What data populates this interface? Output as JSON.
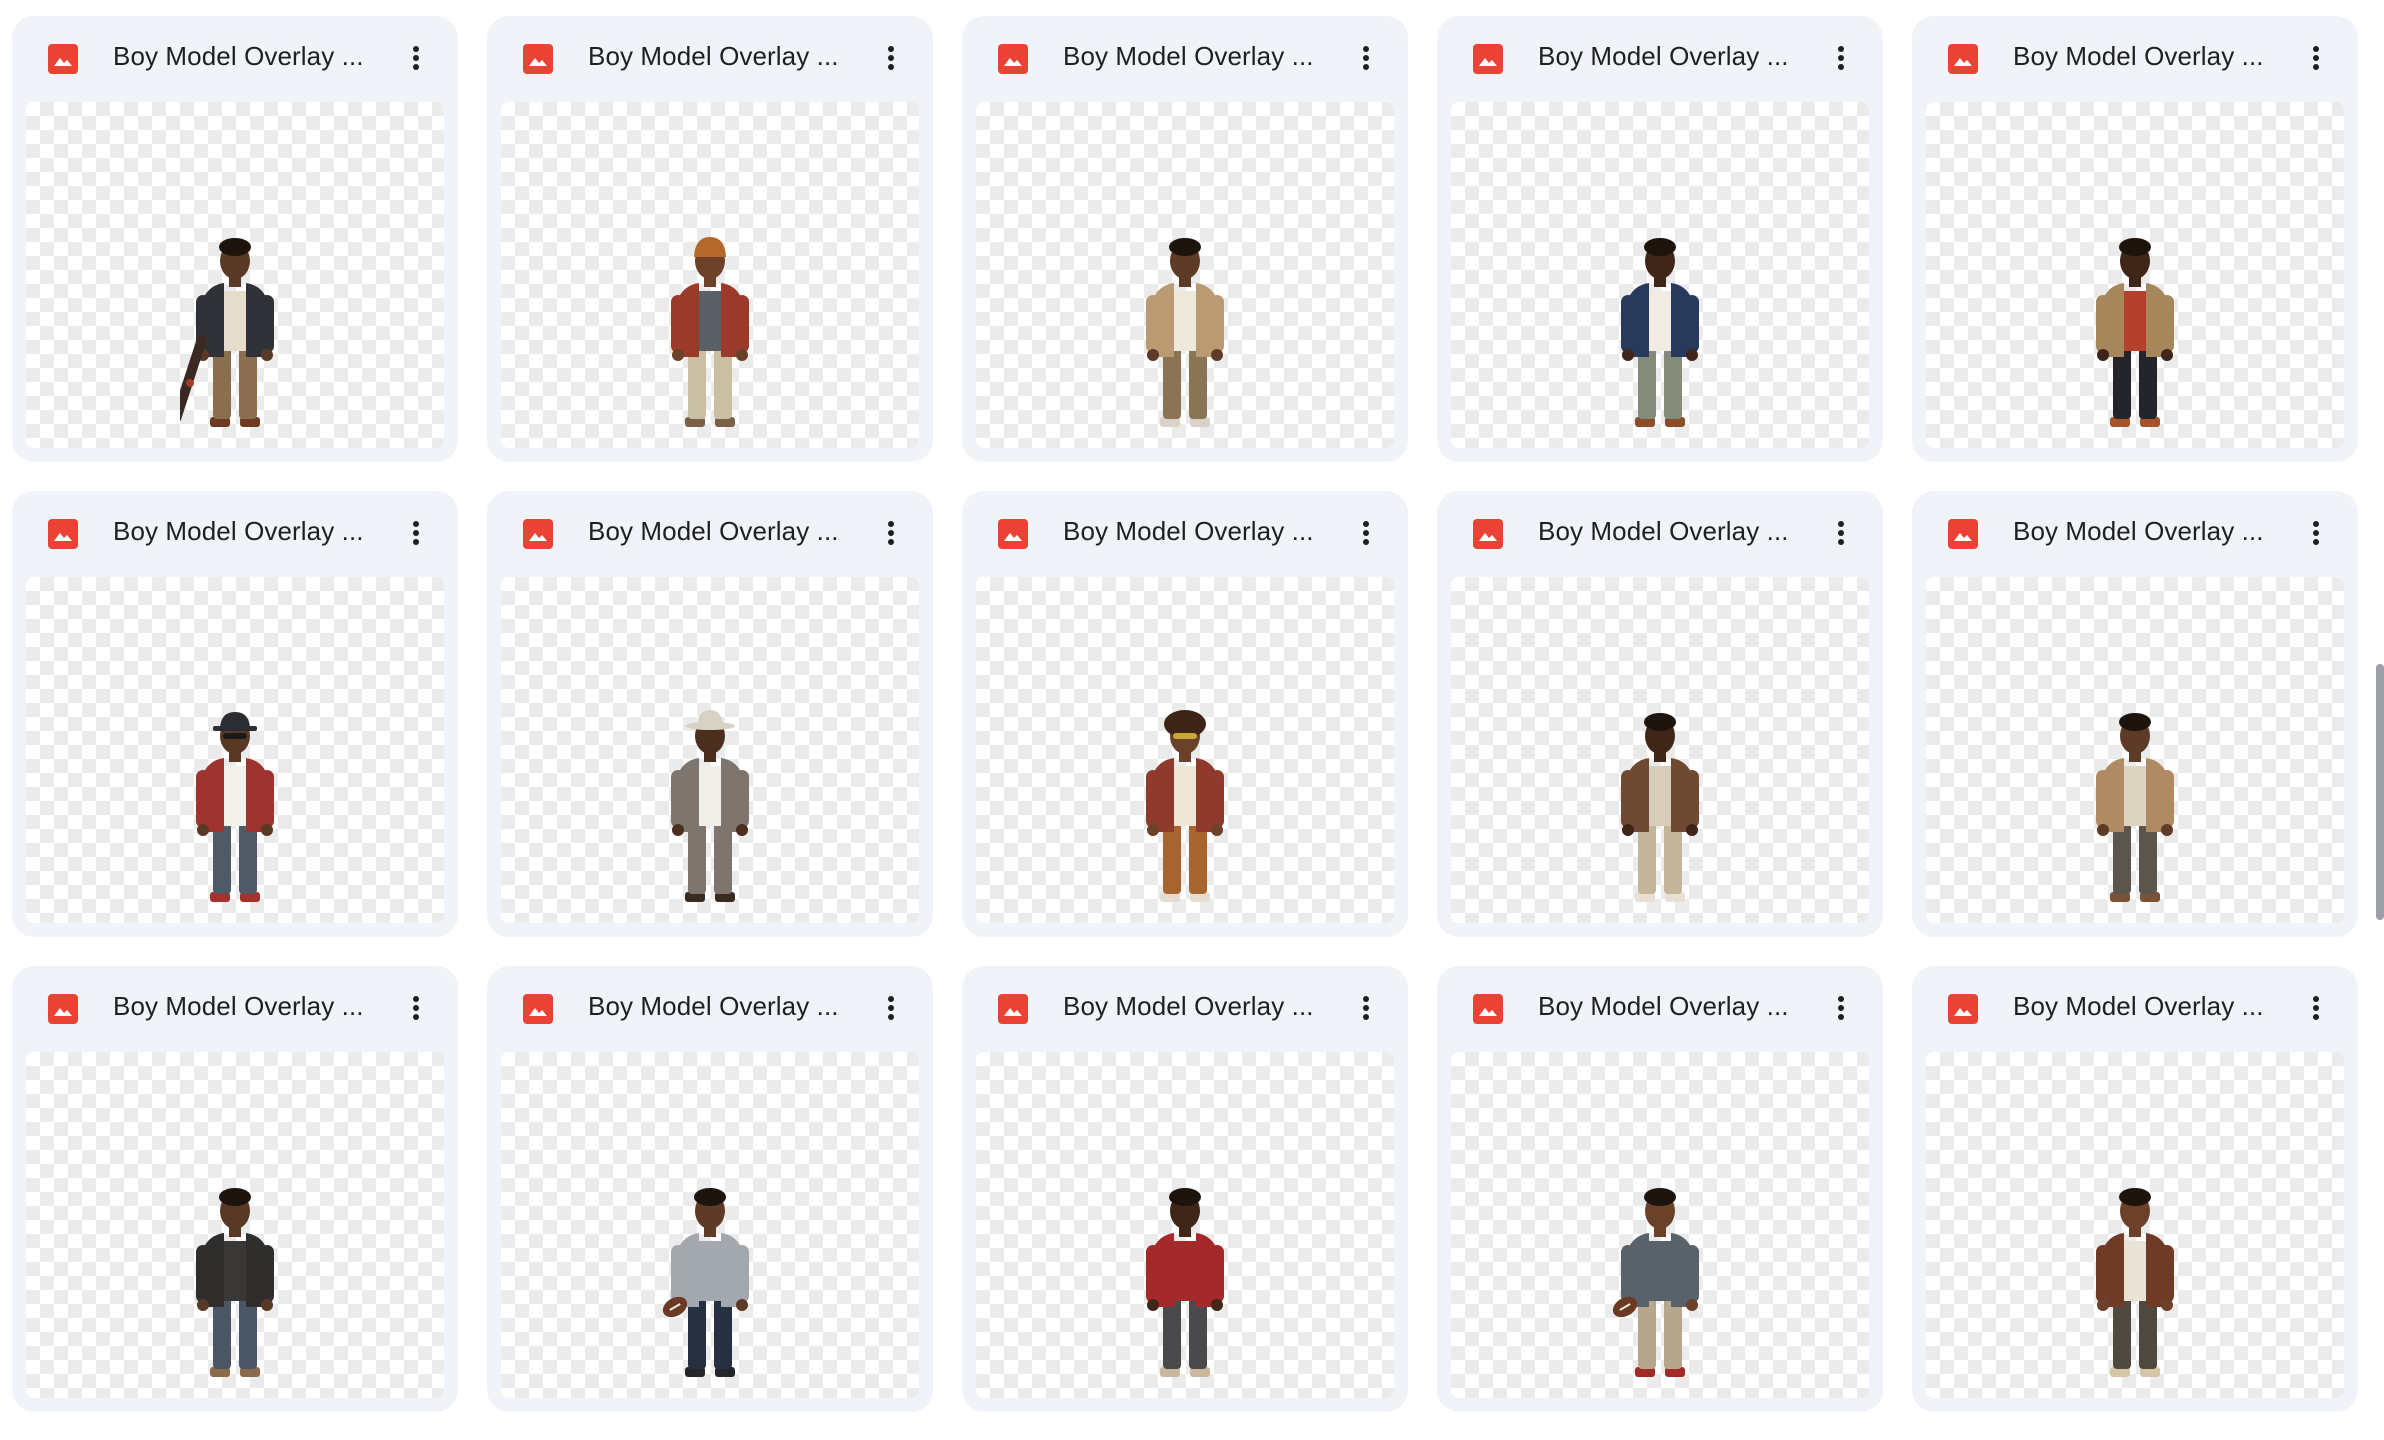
{
  "files": [
    {
      "title": "Boy Model Overlay ...",
      "figure": {
        "jacket": "#2f3236",
        "pants": "#8a6e4f",
        "shirt": "#e6dccb",
        "hat": "none",
        "prop": "skateboard",
        "skin": "#5a3a26",
        "shoes": "#6e3a22"
      }
    },
    {
      "title": "Boy Model Overlay ...",
      "figure": {
        "jacket": "#9b3a2b",
        "pants": "#c9c0a4",
        "shirt": "#5b5f66",
        "hat": "beanie",
        "hat_color": "#b5682c",
        "prop": "none",
        "skin": "#6b4229",
        "shoes": "#7b6048"
      }
    },
    {
      "title": "Boy Model Overlay ...",
      "figure": {
        "jacket": "#b99a73",
        "pants": "#8a7456",
        "shirt": "#efe8dc",
        "hat": "none",
        "prop": "none",
        "skin": "#5e3b26",
        "shoes": "#d9d2c6"
      }
    },
    {
      "title": "Boy Model Overlay ...",
      "figure": {
        "jacket": "#273a5c",
        "pants": "#858b7a",
        "shirt": "#f1ece2",
        "hat": "none",
        "prop": "none",
        "skin": "#3f2618",
        "shoes": "#8a4e2a"
      }
    },
    {
      "title": "Boy Model Overlay ...",
      "figure": {
        "jacket": "#a6875c",
        "pants": "#23252a",
        "shirt": "#b5402e",
        "hat": "none",
        "prop": "none",
        "skin": "#3f2618",
        "shoes": "#a4532a"
      }
    },
    {
      "title": "Boy Model Overlay ...",
      "figure": {
        "jacket": "#9e3330",
        "pants": "#4f5a66",
        "shirt": "#f3f1ec",
        "hat": "bucket",
        "hat_color": "#2b2d33",
        "prop": "none",
        "skin": "#5a3826",
        "shoes": "#a6322b"
      }
    },
    {
      "title": "Boy Model Overlay ...",
      "figure": {
        "jacket": "#7e766e",
        "pants": "#7e766e",
        "shirt": "#f1efe9",
        "hat": "fedora",
        "hat_color": "#d8d2c4",
        "prop": "none",
        "skin": "#4a2e1e",
        "shoes": "#3a2a20"
      }
    },
    {
      "title": "Boy Model Overlay ...",
      "figure": {
        "jacket": "#8f3a2c",
        "pants": "#a8642f",
        "shirt": "#eee6d6",
        "hat": "afro",
        "hat_color": "#3c2416",
        "prop": "none",
        "skin": "#6b4229",
        "shoes": "#e4ddd2"
      }
    },
    {
      "title": "Boy Model Overlay ...",
      "figure": {
        "jacket": "#6e4a33",
        "pants": "#c2b59a",
        "shirt": "#d7cdb9",
        "hat": "none",
        "prop": "none",
        "skin": "#3f2618",
        "shoes": "#e6e0d4"
      }
    },
    {
      "title": "Boy Model Overlay ...",
      "figure": {
        "jacket": "#b08a62",
        "pants": "#5b554e",
        "shirt": "#ded4c2",
        "hat": "none",
        "prop": "none",
        "skin": "#5e3b26",
        "shoes": "#7b5236"
      }
    },
    {
      "title": "Boy Model Overlay ...",
      "figure": {
        "jacket": "#2f2e2c",
        "pants": "#4a5566",
        "shirt": "#3a3836",
        "hat": "none",
        "prop": "none",
        "skin": "#5a3826",
        "shoes": "#8a6a4a"
      }
    },
    {
      "title": "Boy Model Overlay ...",
      "figure": {
        "jacket": "#a3a8ae",
        "pants": "#273040",
        "shirt": "#a3a8ae",
        "hat": "none",
        "prop": "football",
        "skin": "#5e3b26",
        "shoes": "#24262a"
      }
    },
    {
      "title": "Boy Model Overlay ...",
      "figure": {
        "jacket": "#a5282a",
        "pants": "#4a4a4c",
        "shirt": "#a5282a",
        "hat": "none",
        "prop": "none",
        "skin": "#3f2618",
        "shoes": "#c9b89c"
      }
    },
    {
      "title": "Boy Model Overlay ...",
      "figure": {
        "jacket": "#59626a",
        "pants": "#b6a78c",
        "shirt": "#59626a",
        "hat": "none",
        "prop": "football",
        "skin": "#6b4229",
        "shoes": "#a02a26"
      }
    },
    {
      "title": "Boy Model Overlay ...",
      "figure": {
        "jacket": "#6e3b27",
        "pants": "#4e4a3f",
        "shirt": "#e9e3d6",
        "hat": "none",
        "prop": "none",
        "skin": "#6b4229",
        "shoes": "#d6c6a8"
      }
    }
  ]
}
